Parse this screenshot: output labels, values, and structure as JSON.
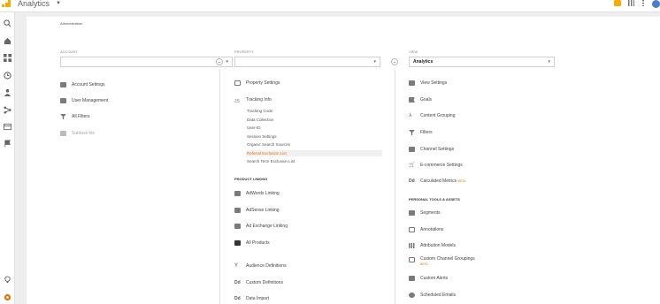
{
  "app": {
    "title": "Analytics"
  },
  "breadcrumb": "Administration",
  "account": {
    "label": "ACCOUNT",
    "items": [
      "Account Settings",
      "User Management",
      "All Filters",
      "Subtask ble"
    ]
  },
  "property": {
    "label": "PROPERTY",
    "items": [
      "Property Settings",
      "Tracking Info"
    ],
    "tracking_sub": [
      "Tracking Code",
      "Data Collection",
      "User-ID",
      "Session Settings",
      "Organic Search Sources",
      "Referral Exclusion List",
      "Search Term Exclusion List"
    ],
    "product_linking_heading": "PRODUCT LINKING",
    "linking_items": [
      "AdWords Linking",
      "AdSense Linking",
      "Ad Exchange Linking",
      "All Products"
    ],
    "bottom_items": [
      "Audience Definitions",
      "Custom Definitions",
      "Data Import"
    ]
  },
  "view": {
    "label": "VIEW",
    "selected": "Analytics",
    "items": [
      "View Settings",
      "Goals",
      "Content Grouping",
      "Filters",
      "Channel Settings",
      "E-commerce Settings",
      "Calculated Metrics"
    ],
    "calculated_metrics_badge": "BETA",
    "personal_heading": "PERSONAL TOOLS & ASSETS",
    "personal_items": [
      "Segments",
      "Annotations",
      "Attribution Models",
      "Custom Channel Groupings",
      "Custom Alerts",
      "Scheduled Emails"
    ],
    "custom_channel_badge": "BETA"
  },
  "colors": {
    "accent": "#e8710a",
    "logo": "#f9ab00",
    "settings_icon": "#e8710a"
  }
}
